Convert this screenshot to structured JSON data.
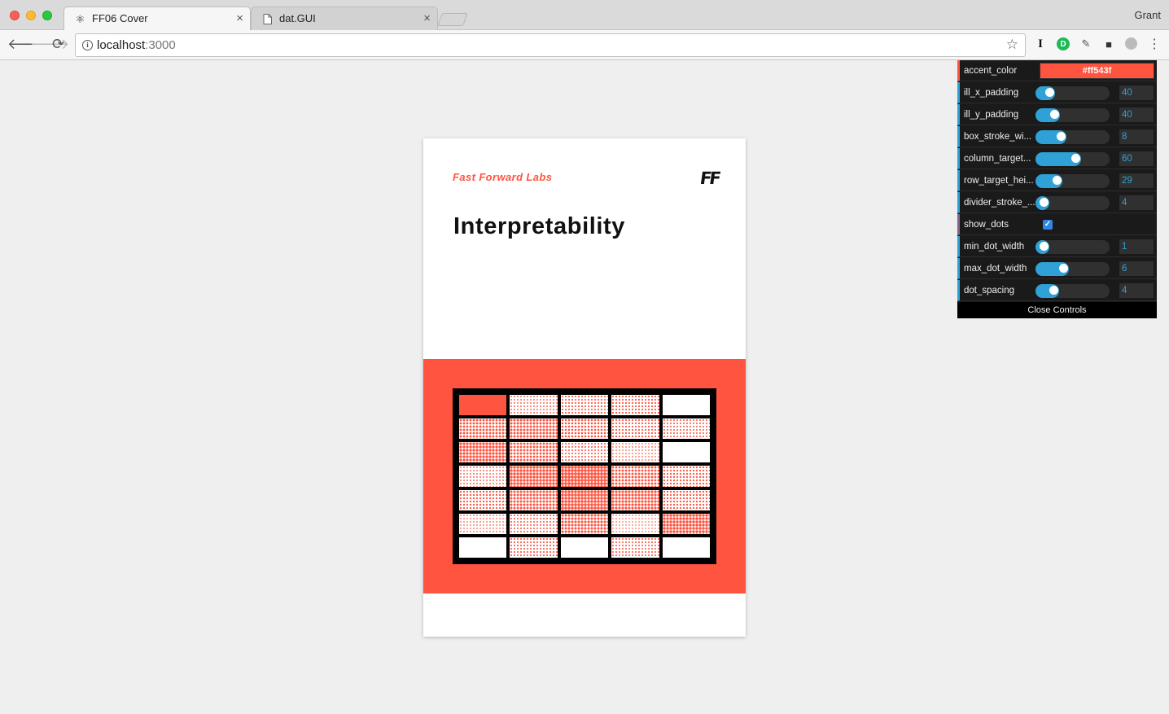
{
  "browser": {
    "profile_name": "Grant",
    "tabs": [
      {
        "title": "FF06 Cover",
        "active": true,
        "icon": "react-icon"
      },
      {
        "title": "dat.GUI",
        "active": false,
        "icon": "document-icon"
      }
    ],
    "address": {
      "host": "localhost",
      "port": ":3000"
    },
    "extensions": [
      "instapaper-icon",
      "grammarly-icon",
      "pin-icon",
      "camera-icon",
      "extension-circle-icon",
      "menu-icon"
    ]
  },
  "cover": {
    "brand": "Fast Forward Labs",
    "logo": "FF",
    "title": "Interpretability",
    "accent": "#ff543f",
    "grid": {
      "columns": 5,
      "rows": 7,
      "intensities": [
        [
          1.0,
          0.15,
          0.25,
          0.3,
          0.0
        ],
        [
          0.55,
          0.6,
          0.45,
          0.3,
          0.2
        ],
        [
          0.75,
          0.55,
          0.2,
          0.1,
          0.0
        ],
        [
          0.15,
          0.8,
          0.9,
          0.55,
          0.35
        ],
        [
          0.35,
          0.6,
          0.85,
          0.7,
          0.35
        ],
        [
          0.1,
          0.2,
          0.65,
          0.05,
          0.8
        ],
        [
          0.0,
          0.25,
          0.0,
          0.2,
          0.0
        ]
      ]
    }
  },
  "gui": {
    "controls": [
      {
        "label": "accent_color",
        "type": "color",
        "value": "#ff543f"
      },
      {
        "label": "ill_x_padding",
        "type": "number",
        "value": "40",
        "fraction": 0.2
      },
      {
        "label": "ill_y_padding",
        "type": "number",
        "value": "40",
        "fraction": 0.26
      },
      {
        "label": "box_stroke_wi...",
        "type": "number",
        "value": "8",
        "fraction": 0.35
      },
      {
        "label": "column_target...",
        "type": "number",
        "value": "60",
        "fraction": 0.55
      },
      {
        "label": "row_target_hei...",
        "type": "number",
        "value": "29",
        "fraction": 0.3
      },
      {
        "label": "divider_stroke_...",
        "type": "number",
        "value": "4",
        "fraction": 0.12
      },
      {
        "label": "show_dots",
        "type": "boolean",
        "value": true,
        "check": "✓"
      },
      {
        "label": "min_dot_width",
        "type": "number",
        "value": "1",
        "fraction": 0.12
      },
      {
        "label": "max_dot_width",
        "type": "number",
        "value": "6",
        "fraction": 0.38
      },
      {
        "label": "dot_spacing",
        "type": "number",
        "value": "4",
        "fraction": 0.25
      }
    ],
    "close_label": "Close Controls"
  }
}
